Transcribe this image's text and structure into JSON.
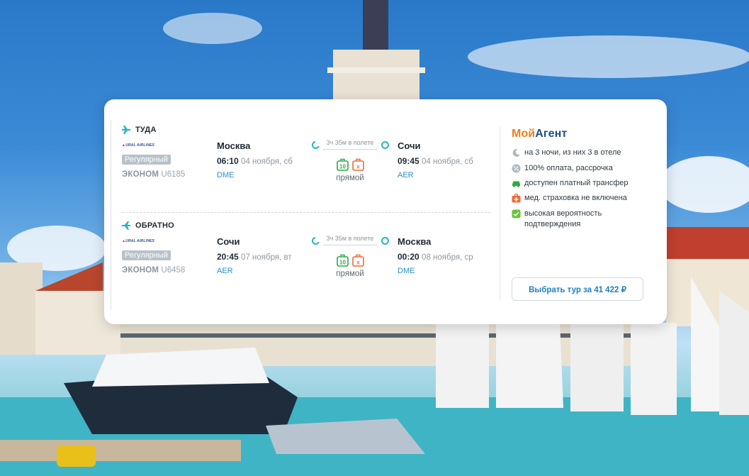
{
  "colors": {
    "accent_teal": "#2ab3c8",
    "link_blue": "#1e7fc2",
    "brand_orange": "#f07d1a",
    "brand_navy": "#1b4f8c",
    "badge_gray": "#b7c1c9"
  },
  "outbound": {
    "direction_label": "ТУДА",
    "direction_icon": "plane-right-icon",
    "airline_logo_text": "URAL AIRLINES",
    "type_badge": "Регулярный",
    "fare_class": "ЭКОНОМ",
    "flight_number": "U6185",
    "depart": {
      "city": "Москва",
      "time": "06:10",
      "date": "04 ноября, сб",
      "code": "DME"
    },
    "arrive": {
      "city": "Сочи",
      "time": "09:45",
      "date": "04 ноября, сб",
      "code": "AER"
    },
    "duration": "3ч 35м в полете",
    "stops": "прямой",
    "baggage": {
      "carry_on_kg": "10",
      "checked": "x"
    }
  },
  "return": {
    "direction_label": "ОБРАТНО",
    "direction_icon": "plane-left-icon",
    "airline_logo_text": "URAL AIRLINES",
    "type_badge": "Регулярный",
    "fare_class": "ЭКОНОМ",
    "flight_number": "U6458",
    "depart": {
      "city": "Сочи",
      "time": "20:45",
      "date": "07 ноября, вт",
      "code": "AER"
    },
    "arrive": {
      "city": "Москва",
      "time": "00:20",
      "date": "08 ноября, ср",
      "code": "DME"
    },
    "duration": "3ч 35м в полете",
    "stops": "прямой",
    "baggage": {
      "carry_on_kg": "10",
      "checked": "x"
    }
  },
  "agent": {
    "logo_part1": "Мой",
    "logo_part2": "Агент",
    "features": [
      {
        "icon": "moon-icon",
        "text": "на 3 ночи, из них 3 в отеле"
      },
      {
        "icon": "percent-icon",
        "text": "100% оплата, рассрочка"
      },
      {
        "icon": "car-icon",
        "text": "доступен платный трансфер"
      },
      {
        "icon": "medkit-icon",
        "text": "мед. страховка не включена"
      },
      {
        "icon": "check-icon",
        "text": "высокая вероятность подтверждения"
      }
    ],
    "cta_label": "Выбрать тур за 41 422 ₽"
  }
}
